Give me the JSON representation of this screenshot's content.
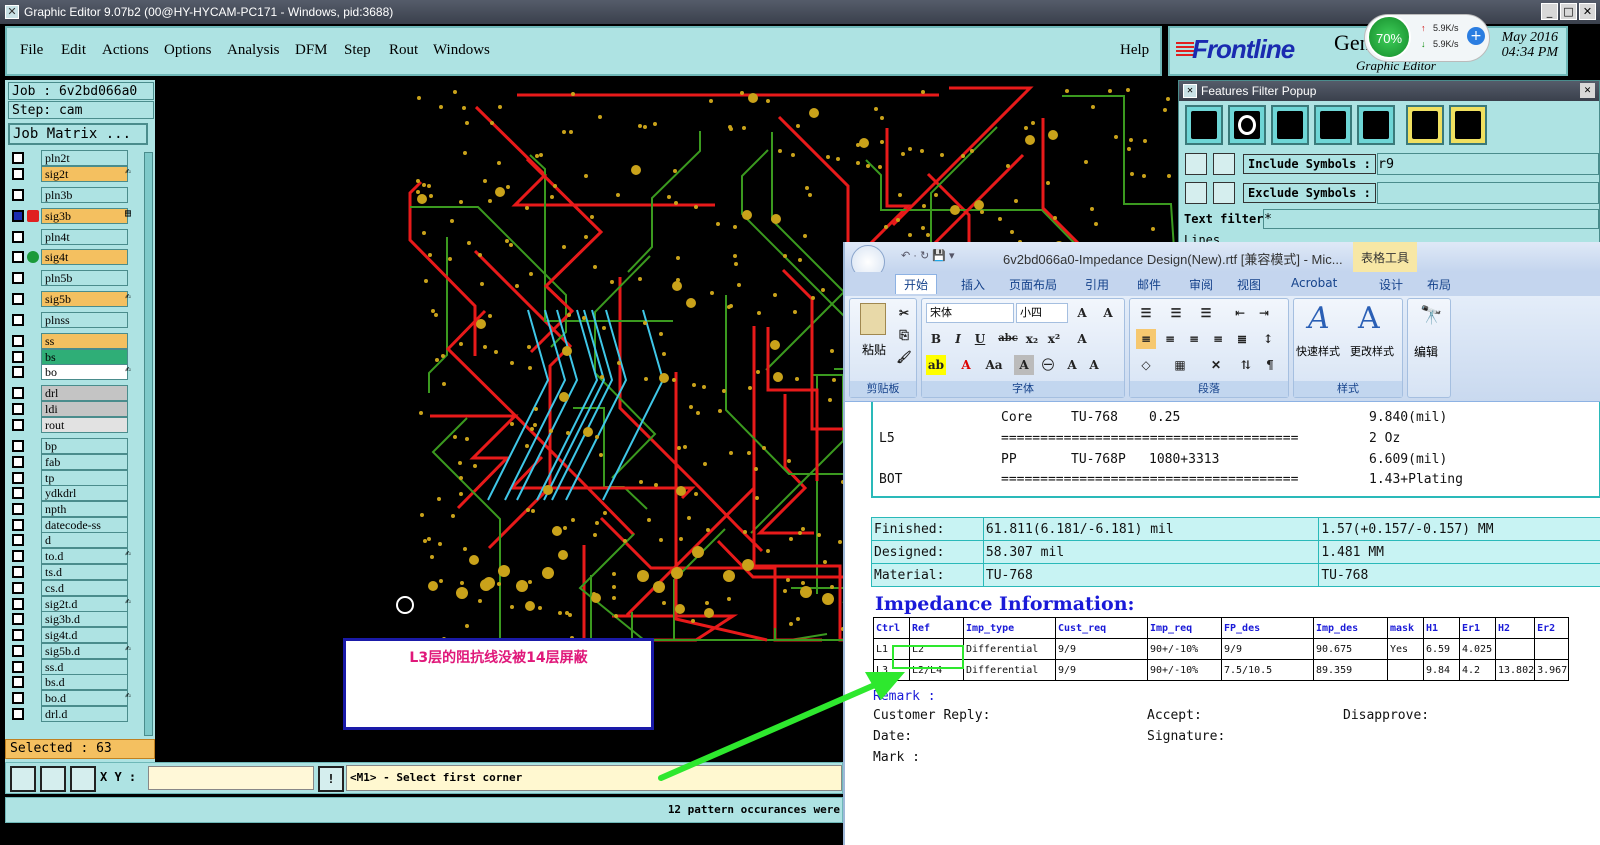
{
  "window": {
    "title": "Graphic Editor 9.07b2 (00@HY-HYCAM-PC171 - Windows, pid:3688)"
  },
  "menu": {
    "file": "File",
    "edit": "Edit",
    "actions": "Actions",
    "options": "Options",
    "analysis": "Analysis",
    "dfm": "DFM",
    "step": "Step",
    "rout": "Rout",
    "windows": "Windows",
    "help": "Help"
  },
  "logo": {
    "brand": "Frontline",
    "gen": "Gen",
    "sub": "Graphic Editor",
    "date1": "May 2016",
    "date2": "04:34 PM"
  },
  "network": {
    "percent": "70%",
    "up": "5.9K/s",
    "down": "5.9K/s"
  },
  "job": {
    "job": "Job : 6v2bd066a0",
    "step": "Step: cam",
    "matrix": "Job Matrix ..."
  },
  "layers": [
    {
      "name": "pln2t",
      "color": "#aee3e3",
      "ind": "",
      "ed": ""
    },
    {
      "name": "sig2t",
      "color": "#f4c060",
      "ind": "",
      "ed": "✍"
    },
    {
      "name": "pln3b",
      "color": "#aee3e3",
      "ind": "",
      "ed": ""
    },
    {
      "name": "sig3b",
      "color": "#f4c060",
      "ind": "red",
      "ed": "▤"
    },
    {
      "name": "pln4t",
      "color": "#aee3e3",
      "ind": "",
      "ed": ""
    },
    {
      "name": "sig4t",
      "color": "#f4c060",
      "ind": "green",
      "ed": ""
    },
    {
      "name": "pln5b",
      "color": "#aee3e3",
      "ind": "",
      "ed": ""
    },
    {
      "name": "sig5b",
      "color": "#f4c060",
      "ind": "",
      "ed": "✍"
    },
    {
      "name": "plnss",
      "color": "#aee3e3",
      "ind": "",
      "ed": ""
    },
    {
      "name": "ss",
      "color": "#f4c060",
      "ind": "",
      "ed": ""
    },
    {
      "name": "bs",
      "color": "#2fae77",
      "ind": "",
      "ed": ""
    },
    {
      "name": "bo",
      "color": "#ffffff",
      "ind": "",
      "ed": "✍"
    },
    {
      "name": "drl",
      "color": "#c4c4c4",
      "ind": "",
      "ed": ""
    },
    {
      "name": "ldi",
      "color": "#c4c4c4",
      "ind": "",
      "ed": ""
    },
    {
      "name": "rout",
      "color": "#e2e2e2",
      "ind": "",
      "ed": ""
    },
    {
      "name": "bp",
      "color": "#aee3e3",
      "ind": "",
      "ed": ""
    },
    {
      "name": "fab",
      "color": "#aee3e3",
      "ind": "",
      "ed": ""
    },
    {
      "name": "tp",
      "color": "#aee3e3",
      "ind": "",
      "ed": ""
    },
    {
      "name": "ydkdrl",
      "color": "#aee3e3",
      "ind": "",
      "ed": ""
    },
    {
      "name": "npth",
      "color": "#aee3e3",
      "ind": "",
      "ed": ""
    },
    {
      "name": "datecode-ss",
      "color": "#aee3e3",
      "ind": "",
      "ed": ""
    },
    {
      "name": "d",
      "color": "#aee3e3",
      "ind": "",
      "ed": ""
    },
    {
      "name": "to.d",
      "color": "#aee3e3",
      "ind": "",
      "ed": "✍"
    },
    {
      "name": "ts.d",
      "color": "#aee3e3",
      "ind": "",
      "ed": ""
    },
    {
      "name": "cs.d",
      "color": "#aee3e3",
      "ind": "",
      "ed": ""
    },
    {
      "name": "sig2t.d",
      "color": "#aee3e3",
      "ind": "",
      "ed": "✍"
    },
    {
      "name": "sig3b.d",
      "color": "#aee3e3",
      "ind": "",
      "ed": ""
    },
    {
      "name": "sig4t.d",
      "color": "#aee3e3",
      "ind": "",
      "ed": ""
    },
    {
      "name": "sig5b.d",
      "color": "#aee3e3",
      "ind": "",
      "ed": "✍"
    },
    {
      "name": "ss.d",
      "color": "#aee3e3",
      "ind": "",
      "ed": ""
    },
    {
      "name": "bs.d",
      "color": "#aee3e3",
      "ind": "",
      "ed": ""
    },
    {
      "name": "bo.d",
      "color": "#aee3e3",
      "ind": "",
      "ed": "✍"
    },
    {
      "name": "drl.d",
      "color": "#aee3e3",
      "ind": "",
      "ed": ""
    }
  ],
  "selected": "Selected : 63",
  "bottom": {
    "xy_label": "X Y :",
    "prompt": "<M1> - Select first corner",
    "status": "12 pattern occurances were"
  },
  "note": "L3层的阻抗线没被14层屏蔽",
  "features_filter": {
    "title": "Features Filter Popup",
    "include": "Include Symbols :",
    "include_val": "r9",
    "exclude": "Exclude Symbols :",
    "exclude_val": "",
    "text_filter": "Text filter",
    "text_val": "*",
    "lines": "Lines"
  },
  "word": {
    "title": "6v2bd066a0-Impedance Design(New).rtf [兼容模式] - Mic...",
    "table_tools": "表格工具",
    "tabs": [
      "开始",
      "插入",
      "页面布局",
      "引用",
      "邮件",
      "审阅",
      "视图",
      "Acrobat",
      "设计",
      "布局"
    ],
    "groups": {
      "clipboard": "剪贴板",
      "font": "字体",
      "paragraph": "段落",
      "styles": "样式"
    },
    "paste": "粘贴",
    "font_name": "宋体",
    "font_size": "小四",
    "quick_style": "快速样式",
    "change_style": "更改样式",
    "edit": "编辑"
  },
  "stackup": [
    {
      "layer": "",
      "mat": "Core",
      "type": "TU-768",
      "thk": "0.25",
      "val": "9.840(mil)"
    },
    {
      "layer": "L5",
      "mat": "======================================",
      "type": "",
      "thk": "",
      "val": "2 Oz"
    },
    {
      "layer": "",
      "mat": "PP",
      "type": "TU-768P",
      "thk": "1080+3313",
      "val": "6.609(mil)"
    },
    {
      "layer": "BOT",
      "mat": "======================================",
      "type": "",
      "thk": "",
      "val": "1.43+Plating"
    }
  ],
  "summary": [
    {
      "label": "Finished:",
      "mil": "61.811(6.181/-6.181) mil",
      "mm": "1.57(+0.157/-0.157) MM"
    },
    {
      "label": "Designed:",
      "mil": "58.307 mil",
      "mm": "1.481 MM"
    },
    {
      "label": "Material:",
      "mil": "TU-768",
      "mm": "TU-768"
    }
  ],
  "impedance": {
    "title": "Impedance Information:",
    "headers": [
      "Ctrl",
      "Ref",
      "Imp_type",
      "Cust_req",
      "Imp_req",
      "FP_des",
      "Imp_des",
      "mask",
      "H1",
      "Er1",
      "H2",
      "Er2"
    ],
    "rows": [
      [
        "L1",
        "L2",
        "Differential",
        "9/9",
        "90+/-10%",
        "9/9",
        "90.675",
        "Yes",
        "6.59",
        "4.025",
        "",
        ""
      ],
      [
        "L3",
        "L2/L4",
        "Differential",
        "9/9",
        "90+/-10%",
        "7.5/10.5",
        "89.359",
        "",
        "9.84",
        "4.2",
        "13.802",
        "3.967"
      ]
    ]
  },
  "remarks": {
    "remark": "Remark :",
    "customer": "Customer Reply:",
    "accept": "Accept:",
    "disapprove": "Disapprove:",
    "date": "Date:",
    "signature": "Signature:",
    "mark": "Mark :"
  },
  "colors": {
    "teal": "#aee3e3",
    "gold": "#f4c060",
    "pcb_red": "#e81a1a",
    "pcb_green": "#3b9a1f",
    "pad_gold": "#c9a21a",
    "arrow": "#2ee82e"
  }
}
